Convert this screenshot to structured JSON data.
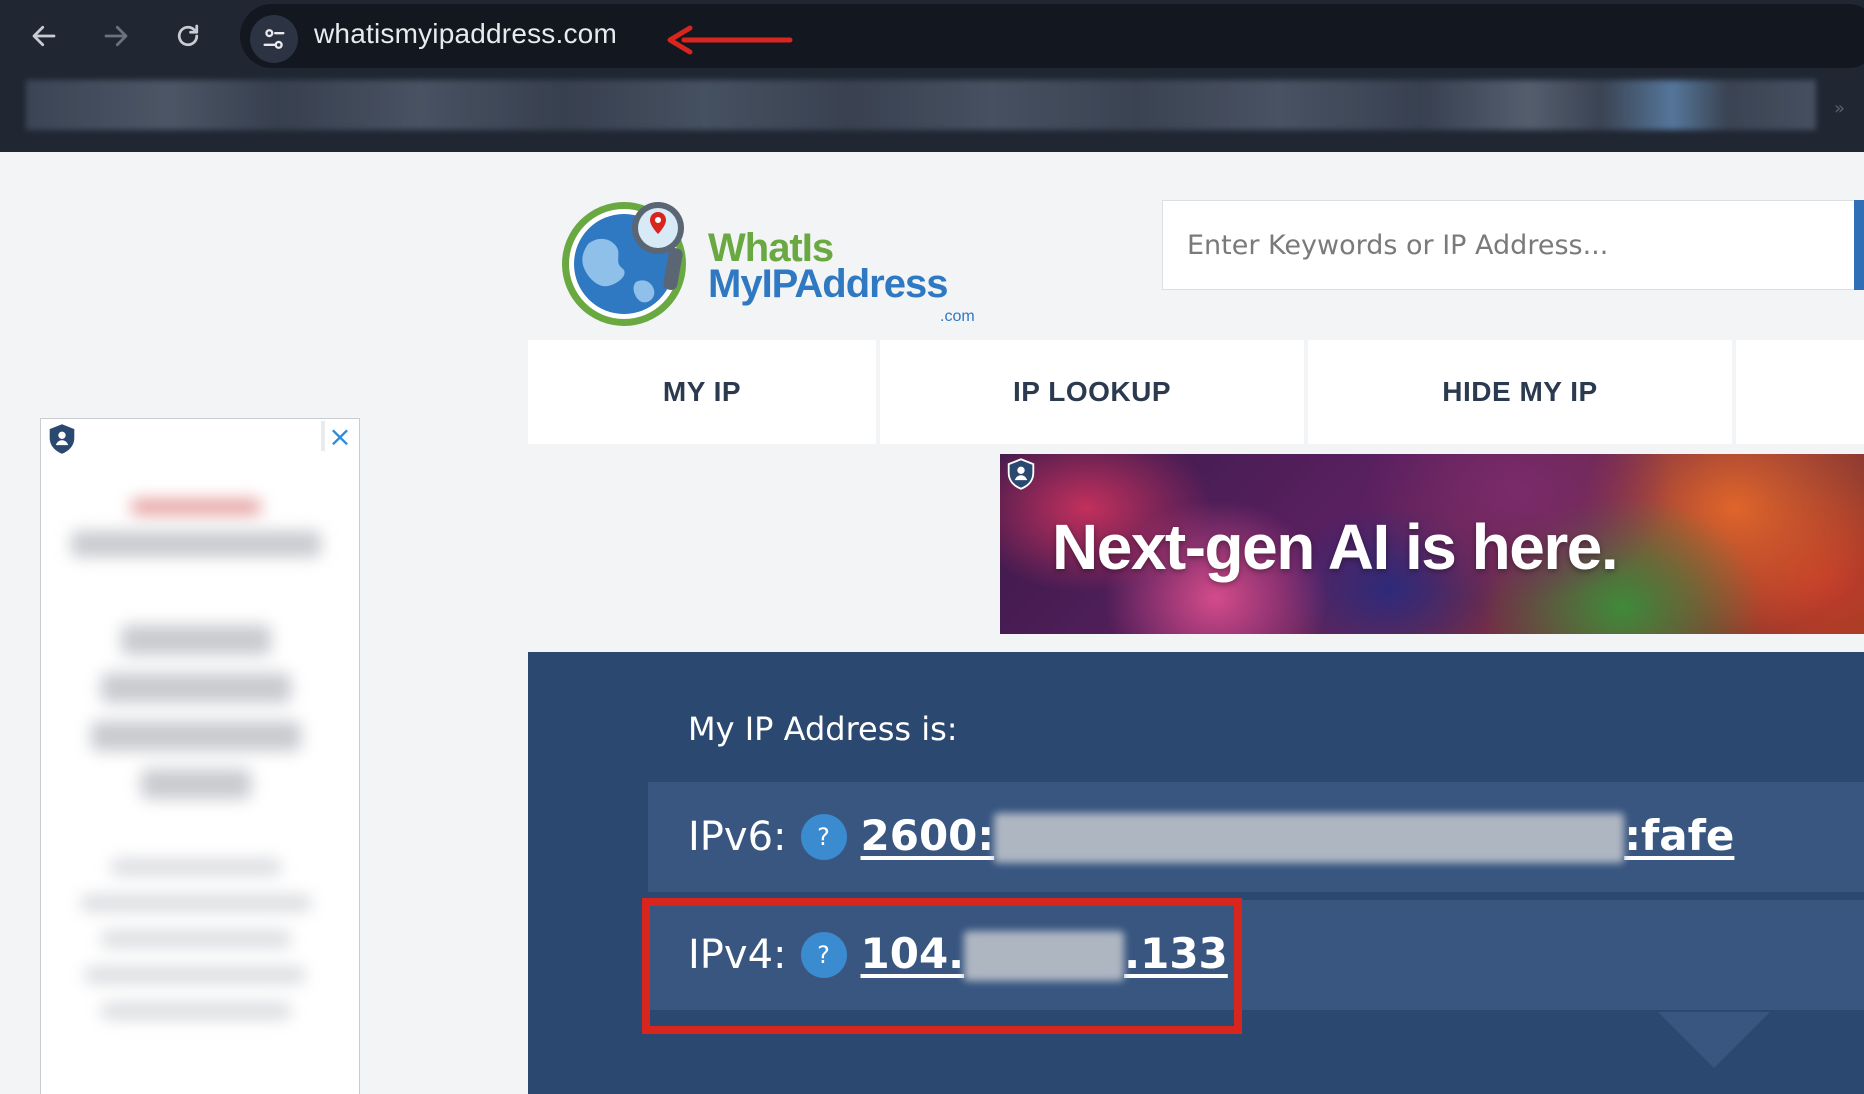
{
  "browser": {
    "url": "whatismyipaddress.com",
    "back_icon": "arrow-left-icon",
    "forward_icon": "arrow-right-icon",
    "reload_icon": "reload-icon",
    "site_info_icon": "tune-icon"
  },
  "logo": {
    "line1": "WhatIs",
    "line2": "MyIPAddress",
    "line3": ".com",
    "colors": {
      "green": "#6aa842",
      "blue": "#2f78c2"
    }
  },
  "search": {
    "placeholder": "Enter Keywords or IP Address..."
  },
  "nav": {
    "tabs": [
      "MY IP",
      "IP LOOKUP",
      "HIDE MY IP"
    ]
  },
  "left_ad": {
    "close_icon": "close-icon",
    "badge_icon": "shield-icon"
  },
  "banner_ad": {
    "text": "Next-gen AI is here.",
    "badge_icon": "shield-icon"
  },
  "ip": {
    "heading": "My IP Address is:",
    "ipv6_label": "IPv6:",
    "ipv6_prefix": "2600:",
    "ipv6_suffix": ":fafe",
    "ipv4_label": "IPv4:",
    "ipv4_prefix": "104.",
    "ipv4_suffix": ".133",
    "help_glyph": "?"
  },
  "colors": {
    "chrome_bg": "#202733",
    "panel_bg": "#2b4870",
    "row_bg": "#385680",
    "callout": "#d8261f",
    "help_bg": "#3a8bd0"
  }
}
